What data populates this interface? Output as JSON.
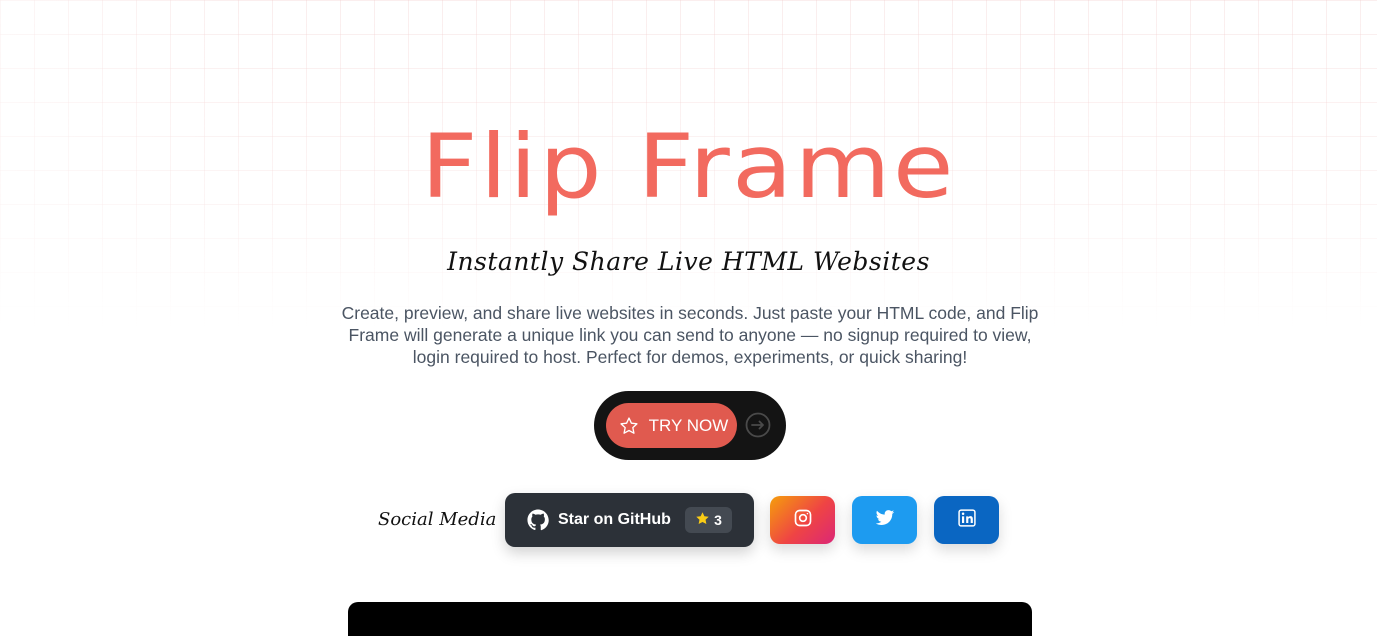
{
  "hero": {
    "title": "Flip Frame",
    "subtitle": "Instantly Share Live HTML Websites",
    "description": "Create, preview, and share live websites in seconds. Just paste your HTML code, and Flip Frame will generate a unique link you can send to anyone — no signup required to view, login required to host. Perfect for demos, experiments, or quick sharing!"
  },
  "cta": {
    "label": "TRY NOW",
    "icons": [
      "star-outline-icon",
      "arrow-right-circle-icon"
    ]
  },
  "social": {
    "label": "Social Media",
    "github": {
      "label": "Star on GitHub",
      "stars": "3",
      "icons": [
        "github-icon",
        "star-icon"
      ]
    },
    "buttons": [
      {
        "name": "instagram",
        "icon": "instagram-icon",
        "color": "#e1306c"
      },
      {
        "name": "twitter",
        "icon": "twitter-icon",
        "color": "#1d9bf0"
      },
      {
        "name": "linkedin",
        "icon": "linkedin-icon",
        "color": "#0a66c2"
      }
    ]
  },
  "colors": {
    "brand": "#f26a5f",
    "cta_button": "#e05a4f",
    "cta_wrap": "#141414",
    "github_button": "#2c3138"
  }
}
